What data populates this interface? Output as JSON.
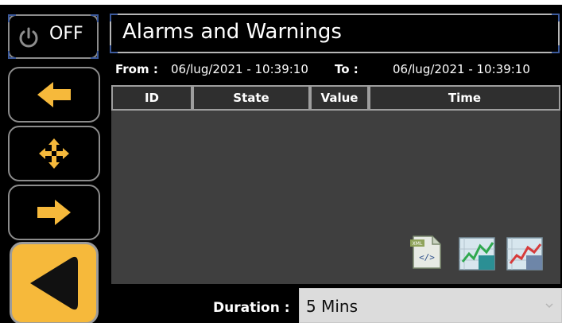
{
  "sidebar": {
    "power": {
      "label": "OFF",
      "icon": "power-icon"
    },
    "left_icon": "arrow-left-icon",
    "move_icon": "move-arrows-icon",
    "right_icon": "arrow-right-icon",
    "back_icon": "back-triangle-icon"
  },
  "header": {
    "title": "Alarms and Warnings"
  },
  "range": {
    "from_label": "From :",
    "from_value": "06/lug/2021 - 10:39:10",
    "to_label": "To :",
    "to_value": "06/lug/2021 - 10:39:10"
  },
  "table": {
    "columns": [
      "ID",
      "State",
      "Value",
      "Time"
    ],
    "rows": []
  },
  "actions": {
    "export_icon": "xml-export-icon",
    "chart_icon": "trend-chart-icon",
    "chart_alt_icon": "trend-chart-red-icon"
  },
  "duration": {
    "label": "Duration :",
    "value": "5 Mins",
    "icon": "chevron-down-icon"
  },
  "colors": {
    "accent": "#f6b93b",
    "border": "#8c8c8c",
    "table_bg": "#3f3f3f",
    "select_bg": "#dcdcdc"
  }
}
